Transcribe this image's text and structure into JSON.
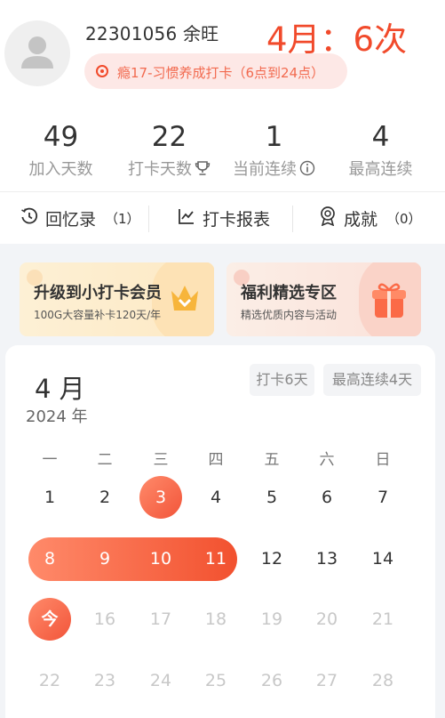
{
  "profile": {
    "user_name": "22301056 余旺",
    "month_count": "4月：6次",
    "tag_text": "瘾17-习惯养成打卡（6点到24点）"
  },
  "stats": [
    {
      "value": "49",
      "label": "加入天数"
    },
    {
      "value": "22",
      "label": "打卡天数"
    },
    {
      "value": "1",
      "label": "当前连续"
    },
    {
      "value": "4",
      "label": "最高连续"
    }
  ],
  "tabs": [
    {
      "label": "回忆录",
      "count": "（1）",
      "icon": "history-icon"
    },
    {
      "label": "打卡报表",
      "count": "",
      "icon": "chart-icon"
    },
    {
      "label": "成就",
      "count": "（0）",
      "icon": "medal-icon"
    }
  ],
  "promos": {
    "vip": {
      "title": "升级到小打卡会员",
      "subtitle": "100G大容量补卡120天/年",
      "icon": "crown-icon"
    },
    "gift": {
      "title": "福利精选专区",
      "subtitle": "精选优质内容与活动",
      "icon": "gift-icon"
    }
  },
  "calendar": {
    "month": "4 月",
    "year": "2024 年",
    "checkin_chip": "打卡6天",
    "streak_chip": "最高连续4天",
    "weekdays": [
      "一",
      "二",
      "三",
      "四",
      "五",
      "六",
      "日"
    ],
    "today_label": "今",
    "weeks": [
      [
        {
          "d": "1"
        },
        {
          "d": "2"
        },
        {
          "d": "3",
          "on": true
        },
        {
          "d": "4"
        },
        {
          "d": "5"
        },
        {
          "d": "6"
        },
        {
          "d": "7"
        }
      ],
      [
        {
          "d": "8",
          "on": true
        },
        {
          "d": "9",
          "on": true
        },
        {
          "d": "10",
          "on": true
        },
        {
          "d": "11",
          "on": true
        },
        {
          "d": "12"
        },
        {
          "d": "13"
        },
        {
          "d": "14"
        }
      ],
      [
        {
          "d": "今",
          "on": true,
          "today": true
        },
        {
          "d": "16",
          "future": true
        },
        {
          "d": "17",
          "future": true
        },
        {
          "d": "18",
          "future": true
        },
        {
          "d": "19",
          "future": true
        },
        {
          "d": "20",
          "future": true
        },
        {
          "d": "21",
          "future": true
        }
      ],
      [
        {
          "d": "22",
          "future": true
        },
        {
          "d": "23",
          "future": true
        },
        {
          "d": "24",
          "future": true
        },
        {
          "d": "25",
          "future": true
        },
        {
          "d": "26",
          "future": true
        },
        {
          "d": "27",
          "future": true
        },
        {
          "d": "28",
          "future": true
        }
      ]
    ]
  },
  "colors": {
    "accent": "#f14a2b",
    "muted": "#999999",
    "future_day": "#c8c8c8"
  }
}
